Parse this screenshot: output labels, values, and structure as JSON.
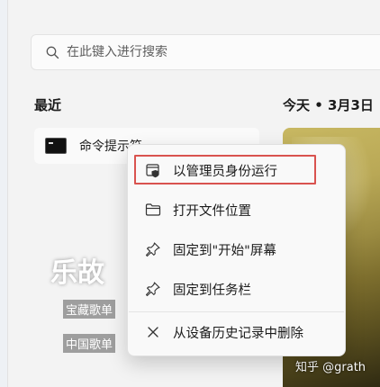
{
  "search": {
    "placeholder": "在此键入进行搜索"
  },
  "recent": {
    "title": "最近",
    "items": [
      {
        "label": "命令提示符"
      }
    ]
  },
  "today": {
    "title": "今天 • 3月3日",
    "card": {
      "big_text": "乐故",
      "line1": "宝藏歌单",
      "line2": "中国歌单",
      "watermark": "知乎 @grath"
    }
  },
  "context_menu": {
    "items": [
      {
        "label": "以管理员身份运行",
        "icon": "admin-shield-icon"
      },
      {
        "label": "打开文件位置",
        "icon": "folder-icon"
      },
      {
        "label": "固定到\"开始\"屏幕",
        "icon": "pin-icon"
      },
      {
        "label": "固定到任务栏",
        "icon": "pin-icon"
      },
      {
        "label": "从设备历史记录中删除",
        "icon": "close-icon"
      }
    ],
    "highlight_color": "#d9534f"
  }
}
